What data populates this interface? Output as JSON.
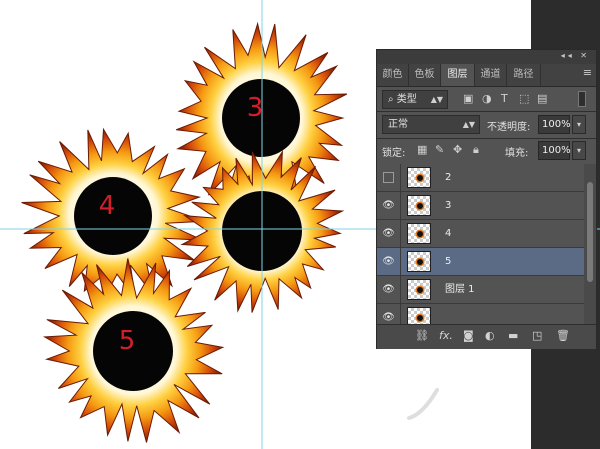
{
  "canvas": {
    "suns": [
      {
        "label": "3",
        "color": "#d21f2a"
      },
      {
        "label": "4",
        "color": "#d21f2a"
      },
      {
        "label": "",
        "color": "#d21f2a"
      },
      {
        "label": "5",
        "color": "#d21f2a"
      }
    ],
    "guide_color": "#7fd6e6"
  },
  "panel": {
    "topbar_buttons": "◂◂ ✕",
    "tabs": [
      "颜色",
      "色板",
      "图层",
      "通道",
      "路径"
    ],
    "active_tab": "图层",
    "filter": {
      "icon": "search-icon",
      "label": "类型"
    },
    "filter_icons": [
      "image-icon",
      "adjust-icon",
      "text-icon",
      "shape-icon",
      "smart-object-icon"
    ],
    "blend_mode": "正常",
    "opacity_label": "不透明度:",
    "opacity_value": "100%",
    "lock_label": "锁定:",
    "lock_icons": [
      "lock-transparent-icon",
      "lock-paint-icon",
      "lock-move-icon",
      "lock-all-icon"
    ],
    "fill_label": "填充:",
    "fill_value": "100%",
    "layers": [
      {
        "name": "2",
        "visible": false,
        "selected": false
      },
      {
        "name": "3",
        "visible": true,
        "selected": false
      },
      {
        "name": "4",
        "visible": true,
        "selected": false
      },
      {
        "name": "5",
        "visible": true,
        "selected": true
      },
      {
        "name": "图层 1",
        "visible": true,
        "selected": false
      },
      {
        "name": "",
        "visible": true,
        "selected": false
      }
    ],
    "footer_icons": [
      "link-icon",
      "fx-icon",
      "mask-icon",
      "adjustment-icon",
      "folder-icon",
      "new-layer-icon",
      "trash-icon"
    ]
  }
}
